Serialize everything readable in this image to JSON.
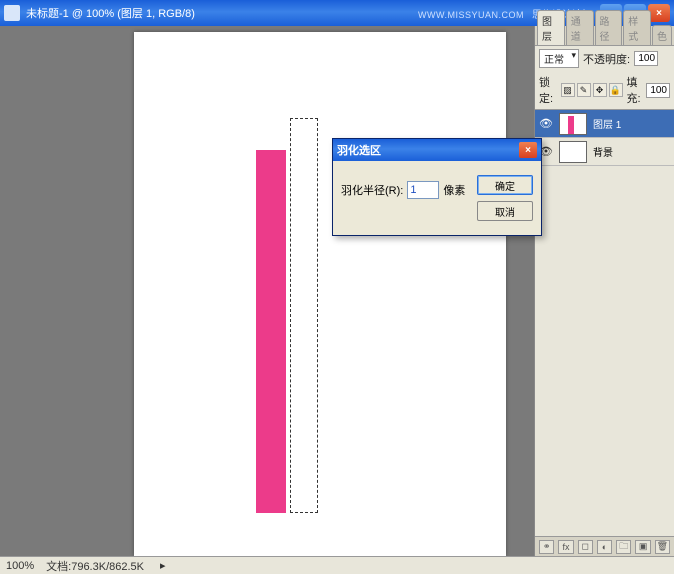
{
  "titlebar": {
    "title": "未标题-1 @ 100% (图层 1, RGB/8)",
    "watermark": "思缘设计论坛",
    "url_watermark": "WWW.MISSYUAN.COM"
  },
  "panel": {
    "tabs": {
      "layers": "图层",
      "channels": "通道",
      "paths": "路径",
      "styles": "样式",
      "color": "色"
    },
    "blend_mode": "正常",
    "opacity_label": "不透明度:",
    "opacity_value": "100",
    "lock_label": "锁定:",
    "fill_label": "填充:",
    "fill_value": "100",
    "layers": [
      {
        "name": "图层 1",
        "active": true
      },
      {
        "name": "背景",
        "active": false
      }
    ]
  },
  "dialog": {
    "title": "羽化选区",
    "radius_label": "羽化半径(R):",
    "radius_value": "1",
    "unit": "像素",
    "ok": "确定",
    "cancel": "取消"
  },
  "statusbar": {
    "zoom": "100%",
    "doc_label": "文档:",
    "doc_size": "796.3K/862.5K"
  }
}
